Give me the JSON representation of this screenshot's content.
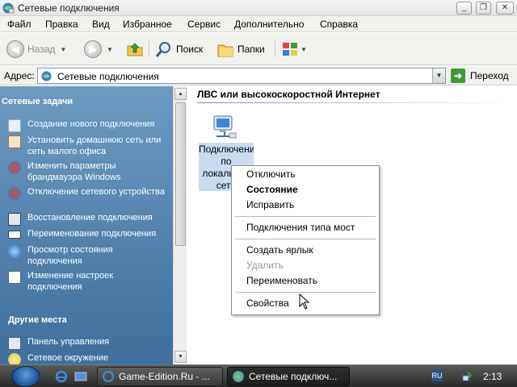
{
  "window": {
    "title": "Сетевые подключения",
    "controls": {
      "minimize": "_",
      "maximize": "❐",
      "close": "✕"
    }
  },
  "menu": [
    "Файл",
    "Правка",
    "Вид",
    "Избранное",
    "Сервис",
    "Дополнительно",
    "Справка"
  ],
  "toolbar": {
    "back_label": "Назад",
    "search_label": "Поиск",
    "folders_label": "Папки",
    "icons": [
      "back-arrow-icon",
      "forward-arrow-icon",
      "up-folder-icon",
      "search-icon",
      "folders-icon",
      "views-icon"
    ]
  },
  "address": {
    "label": "Адрес:",
    "value": "Сетевые подключения",
    "go_label": "Переход"
  },
  "left_pane": {
    "network_tasks": {
      "title": "Сетевые задачи",
      "items": [
        {
          "label": "Создание нового подключения",
          "icon": "new-connection-icon"
        },
        {
          "label": "Установить домашнюю сеть или сеть малого офиса",
          "icon": "home-network-icon"
        },
        {
          "label": "Изменить параметры брандмауэра Windows",
          "icon": "firewall-icon"
        },
        {
          "label": "Отключение сетевого устройства",
          "icon": "disable-device-icon"
        },
        {
          "label": "Восстановление подключения",
          "icon": "repair-icon"
        },
        {
          "label": "Переименование подключения",
          "icon": "rename-icon"
        },
        {
          "label": "Просмотр состояния подключения",
          "icon": "status-icon"
        },
        {
          "label": "Изменение настроек подключения",
          "icon": "settings-icon"
        }
      ]
    },
    "other_places": {
      "title": "Другие места",
      "items": [
        {
          "label": "Панель управления",
          "icon": "control-panel-icon"
        },
        {
          "label": "Сетевое окружение",
          "icon": "network-places-icon"
        }
      ]
    }
  },
  "content": {
    "group_header": "ЛВС или высокоскоростной Интернет",
    "connection_label": "Подключение по локальной сети"
  },
  "context_menu": {
    "items": [
      {
        "label": "Отключить",
        "bold": false,
        "disabled": false
      },
      {
        "label": "Состояние",
        "bold": true,
        "disabled": false
      },
      {
        "label": "Исправить",
        "bold": false,
        "disabled": false
      },
      {
        "label": "Подключения типа мост",
        "bold": false,
        "disabled": false
      },
      {
        "label": "Создать ярлык",
        "bold": false,
        "disabled": false
      },
      {
        "label": "Удалить",
        "bold": false,
        "disabled": true
      },
      {
        "label": "Переименовать",
        "bold": false,
        "disabled": false
      },
      {
        "label": "Свойства",
        "bold": false,
        "disabled": false
      }
    ]
  },
  "taskbar": {
    "buttons": [
      {
        "label": "Game-Edition.Ru - ...",
        "active": false
      },
      {
        "label": "Сетевые подключ...",
        "active": true
      }
    ],
    "language": "RU",
    "clock": "2:13"
  },
  "colors": {
    "left_pane_top": "#6c9ac0",
    "left_pane_bottom": "#3e6f9d",
    "selection": "#c9dcef",
    "taskbar": "#2a2a2a"
  }
}
